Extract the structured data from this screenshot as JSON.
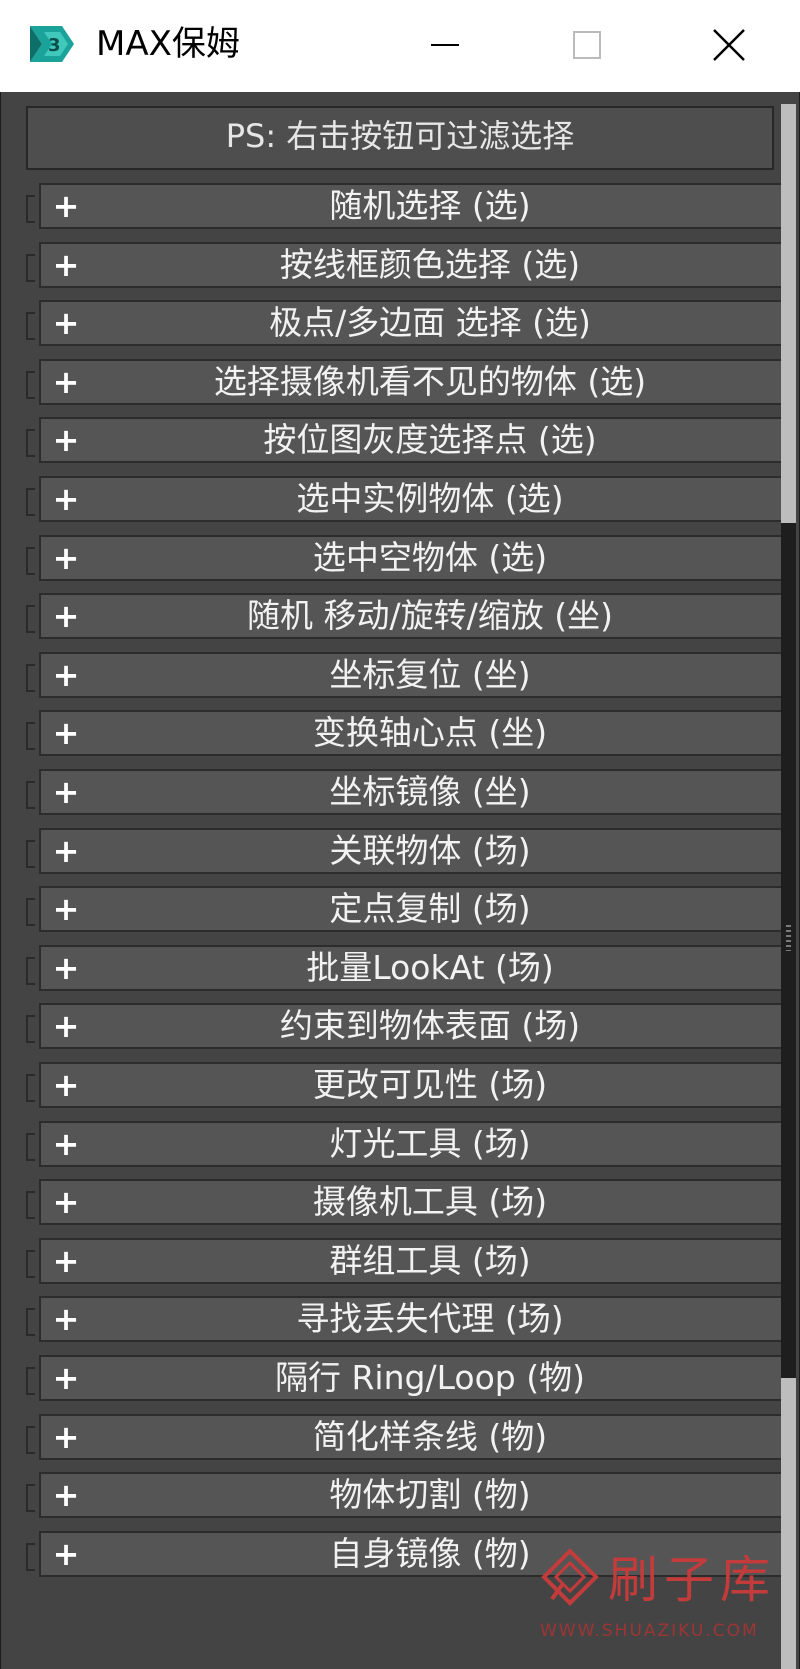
{
  "window": {
    "title": "MAX保姆",
    "minimize_glyph": "—",
    "maximize_glyph": "□",
    "close_glyph": "×"
  },
  "header": {
    "note": "PS: 右击按钮可过滤选择"
  },
  "item_prefix": "+",
  "items": [
    "随机选择 (选)",
    "按线框颜色选择 (选)",
    "极点/多边面 选择 (选)",
    "选择摄像机看不见的物体 (选)",
    "按位图灰度选择点 (选)",
    "选中实例物体 (选)",
    "选中空物体 (选)",
    "随机 移动/旋转/缩放 (坐)",
    "坐标复位 (坐)",
    "变换轴心点 (坐)",
    "坐标镜像 (坐)",
    "关联物体 (场)",
    "定点复制 (场)",
    "批量LookAt (场)",
    "约束到物体表面 (场)",
    "更改可见性 (场)",
    "灯光工具 (场)",
    "摄像机工具 (场)",
    "群组工具 (场)",
    "寻找丢失代理 (场)",
    "隔行 Ring/Loop (物)",
    "简化样条线 (物)",
    "物体切割 (物)",
    "自身镜像 (物)"
  ],
  "watermark": {
    "text": "刷子库",
    "url": "WWW.SHUAZIKU.COM"
  },
  "colors": {
    "panel_bg": "#444444",
    "button_bg": "#555555",
    "button_text": "#f2f2f2",
    "watermark": "#c43b3b"
  }
}
